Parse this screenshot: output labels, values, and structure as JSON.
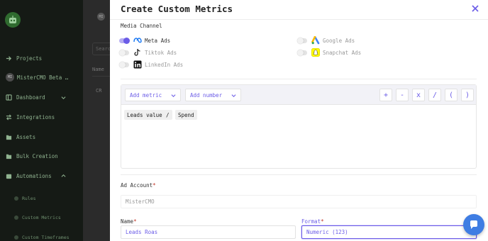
{
  "sidebar": {
    "items": [
      {
        "label": "Projects",
        "icon": "arrow-right-icon"
      },
      {
        "label": "MisterCMO Beta …",
        "icon": "avatar",
        "avatar_text": "MI"
      },
      {
        "label": "Dashboard",
        "icon": "grid-icon"
      },
      {
        "label": "Integrations",
        "icon": "arrows-icon"
      },
      {
        "label": "Assets",
        "icon": "folder-icon"
      },
      {
        "label": "Bulk Creation",
        "icon": "folder-icon"
      },
      {
        "label": "Automations",
        "icon": "layers-icon"
      }
    ],
    "subitems": [
      "Rules",
      "Custom Metrics",
      "Custom Timeframes"
    ]
  },
  "background": {
    "avatar_text": "MI",
    "search_placeholder": "Searc",
    "column": "Name",
    "cell": "CR"
  },
  "modal": {
    "title": "Create Custom Metrics",
    "media_channel": {
      "label": "Media Channel",
      "platforms": [
        {
          "name": "Meta Ads",
          "enabled": true,
          "icon": "meta-icon"
        },
        {
          "name": "Google Ads",
          "enabled": false,
          "icon": "google-ads-icon"
        },
        {
          "name": "Tiktok Ads",
          "enabled": false,
          "icon": "tiktok-icon"
        },
        {
          "name": "Snapchat Ads",
          "enabled": false,
          "icon": "snapchat-icon"
        },
        {
          "name": "LinkedIn Ads",
          "enabled": false,
          "icon": "linkedin-icon"
        }
      ]
    },
    "builder": {
      "add_metric": "Add metric",
      "add_number": "Add number",
      "operators": [
        "+",
        "-",
        "x",
        "/",
        "(",
        ")"
      ],
      "tokens": [
        "Leads value",
        "/",
        "Spend"
      ]
    },
    "ad_account": {
      "label": "Ad Account",
      "required_mark": "*",
      "value": "MisterCMO"
    },
    "name": {
      "label": "Name",
      "required_mark": "*",
      "value": "Leads Roas"
    },
    "format": {
      "label": "Format",
      "required_mark": "*",
      "value": "Numeric (123)"
    }
  },
  "colors": {
    "accent": "#6b5ce7",
    "sidebar_bg": "#151a15",
    "sidebar_text": "#8fb28f",
    "chat_bubble": "#3f7de3"
  }
}
